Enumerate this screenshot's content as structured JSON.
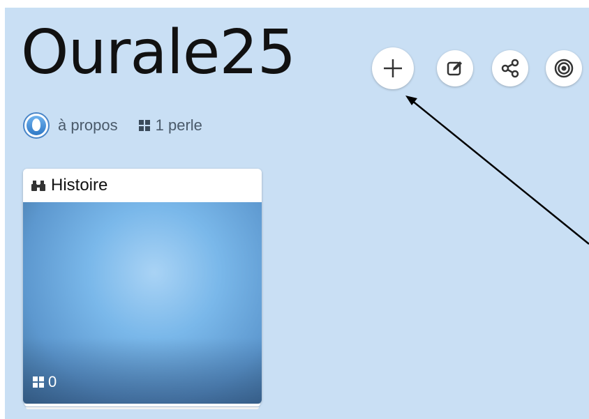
{
  "page": {
    "title": "Ourale25",
    "background_color": "#c9dff4"
  },
  "actions": {
    "add": "plus-icon",
    "edit": "edit-icon",
    "share": "share-icon",
    "target": "target-icon"
  },
  "meta": {
    "about_label": "à propos",
    "pearls_count_label": "1 perle"
  },
  "card": {
    "title": "Histoire",
    "icon": "binoculars-icon",
    "count": "0"
  },
  "annotation": {
    "arrow_color": "#000000"
  }
}
